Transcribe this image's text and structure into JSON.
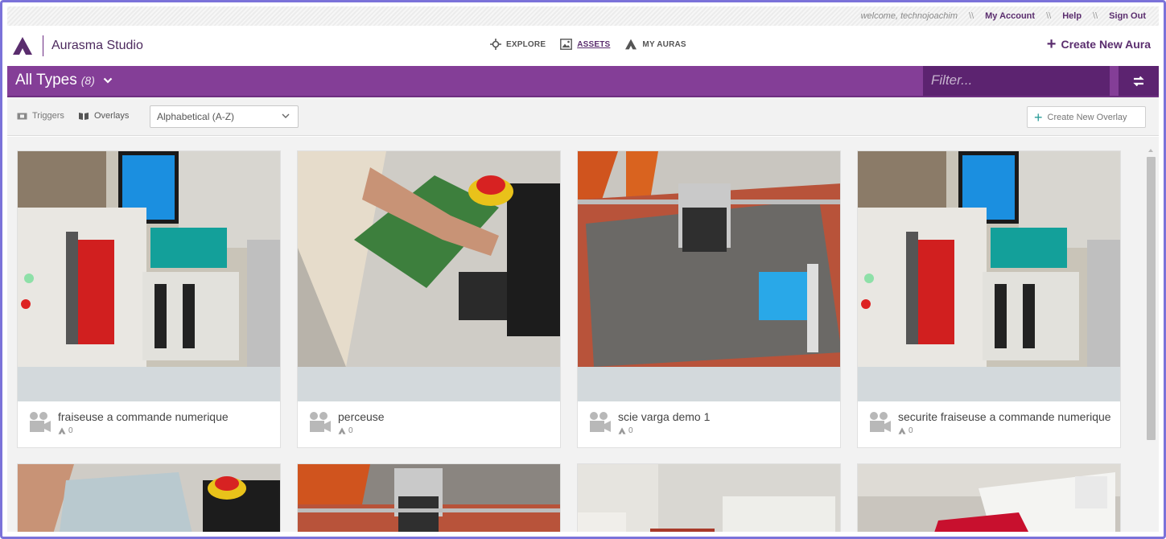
{
  "utilbar": {
    "welcome": "welcome, technojoachim",
    "separator": "\\\\",
    "my_account": "My Account",
    "help": "Help",
    "sign_out": "Sign Out"
  },
  "header": {
    "app_name": "Aurasma Studio",
    "nav": [
      {
        "label": "EXPLORE",
        "icon": "crosshair-icon",
        "active": false
      },
      {
        "label": "ASSETS",
        "icon": "image-icon",
        "active": true
      },
      {
        "label": "MY AURAS",
        "icon": "aura-logo-icon",
        "active": false
      }
    ],
    "create_aura": "Create New Aura"
  },
  "typebar": {
    "type_label": "All Types",
    "type_count": "(8)",
    "filter_placeholder": "Filter..."
  },
  "filterrow": {
    "triggers_label": "Triggers",
    "overlays_label": "Overlays",
    "sort_value": "Alphabetical (A-Z)",
    "create_overlay": "Create New Overlay"
  },
  "colors": {
    "brand_purple": "#843e97",
    "dark_purple": "#5c2370",
    "text_purple": "#5a2d6e",
    "accent_teal": "#2a9c98"
  },
  "assets": [
    {
      "title": "fraiseuse a commande numerique",
      "auras": "0",
      "icon": "video-camera-icon"
    },
    {
      "title": "perceuse",
      "auras": "0",
      "icon": "video-camera-icon"
    },
    {
      "title": "scie varga demo 1",
      "auras": "0",
      "icon": "video-camera-icon"
    },
    {
      "title": "securite fraiseuse a commande numerique",
      "auras": "0",
      "icon": "video-camera-icon"
    }
  ]
}
